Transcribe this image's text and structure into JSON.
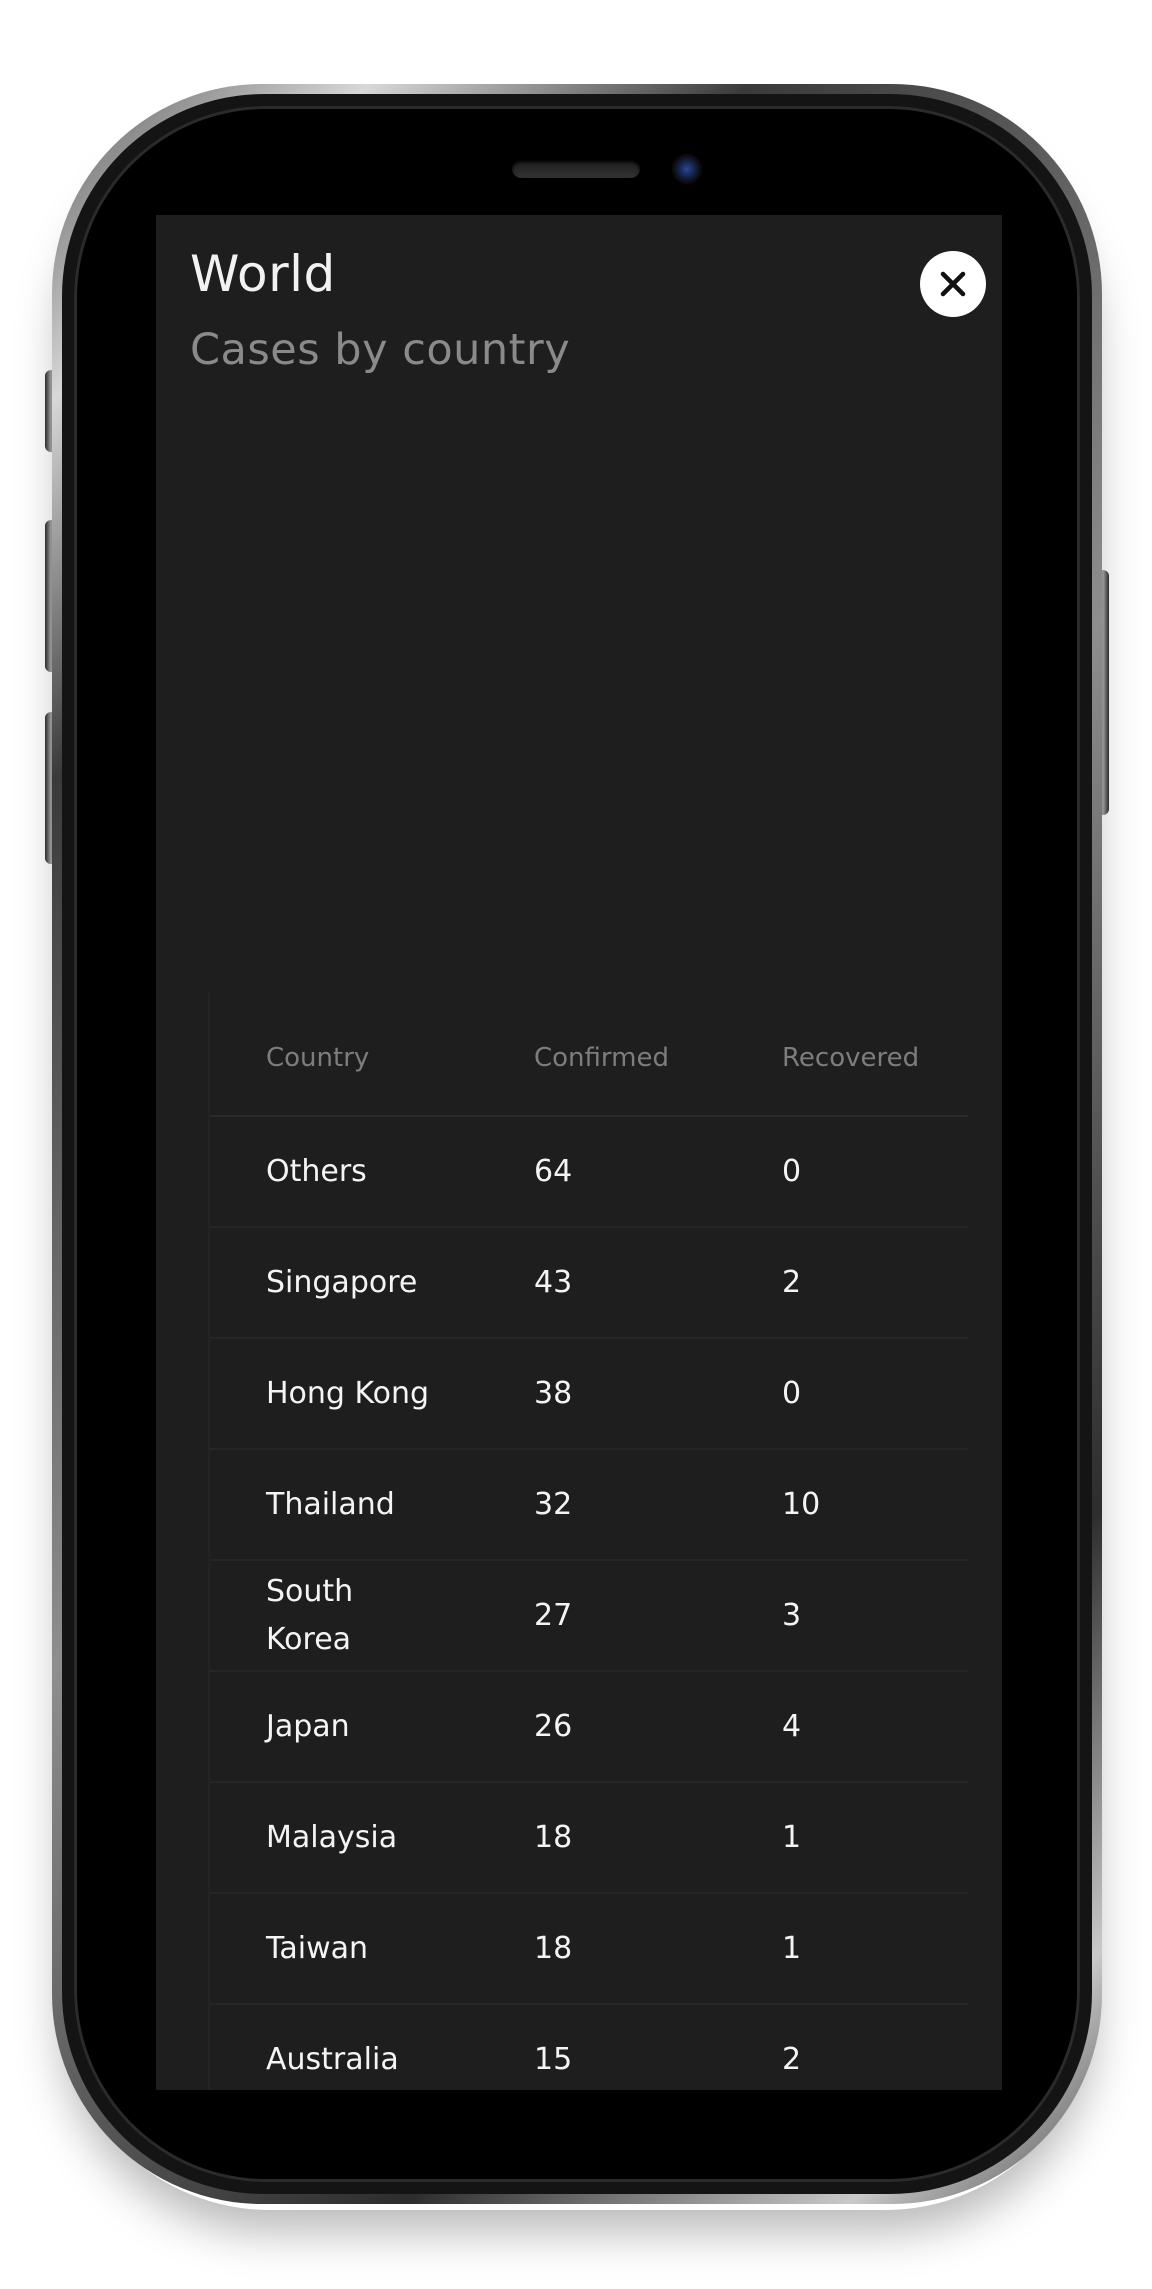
{
  "header": {
    "title": "World",
    "subtitle": "Cases by country"
  },
  "close_icon": "close-icon",
  "table": {
    "columns": {
      "country": "Country",
      "confirmed": "Confirmed",
      "recovered": "Recovered"
    },
    "rows": [
      {
        "country": "Others",
        "confirmed": "64",
        "recovered": "0"
      },
      {
        "country": "Singapore",
        "confirmed": "43",
        "recovered": "2"
      },
      {
        "country": "Hong Kong",
        "confirmed": "38",
        "recovered": "0"
      },
      {
        "country": "Thailand",
        "confirmed": "32",
        "recovered": "10"
      },
      {
        "country": "South Korea",
        "confirmed": "27",
        "recovered": "3"
      },
      {
        "country": "Japan",
        "confirmed": "26",
        "recovered": "4"
      },
      {
        "country": "Malaysia",
        "confirmed": "18",
        "recovered": "1"
      },
      {
        "country": "Taiwan",
        "confirmed": "18",
        "recovered": "1"
      },
      {
        "country": "Australia",
        "confirmed": "15",
        "recovered": "2"
      }
    ]
  },
  "colors": {
    "screen_background": "#1e1e1e",
    "title_text": "#f2f2f2",
    "subtitle_text": "#8a8a8a",
    "header_text": "#7d7d7d",
    "cell_text": "#f4f4f4",
    "close_button_bg": "#ffffff"
  }
}
